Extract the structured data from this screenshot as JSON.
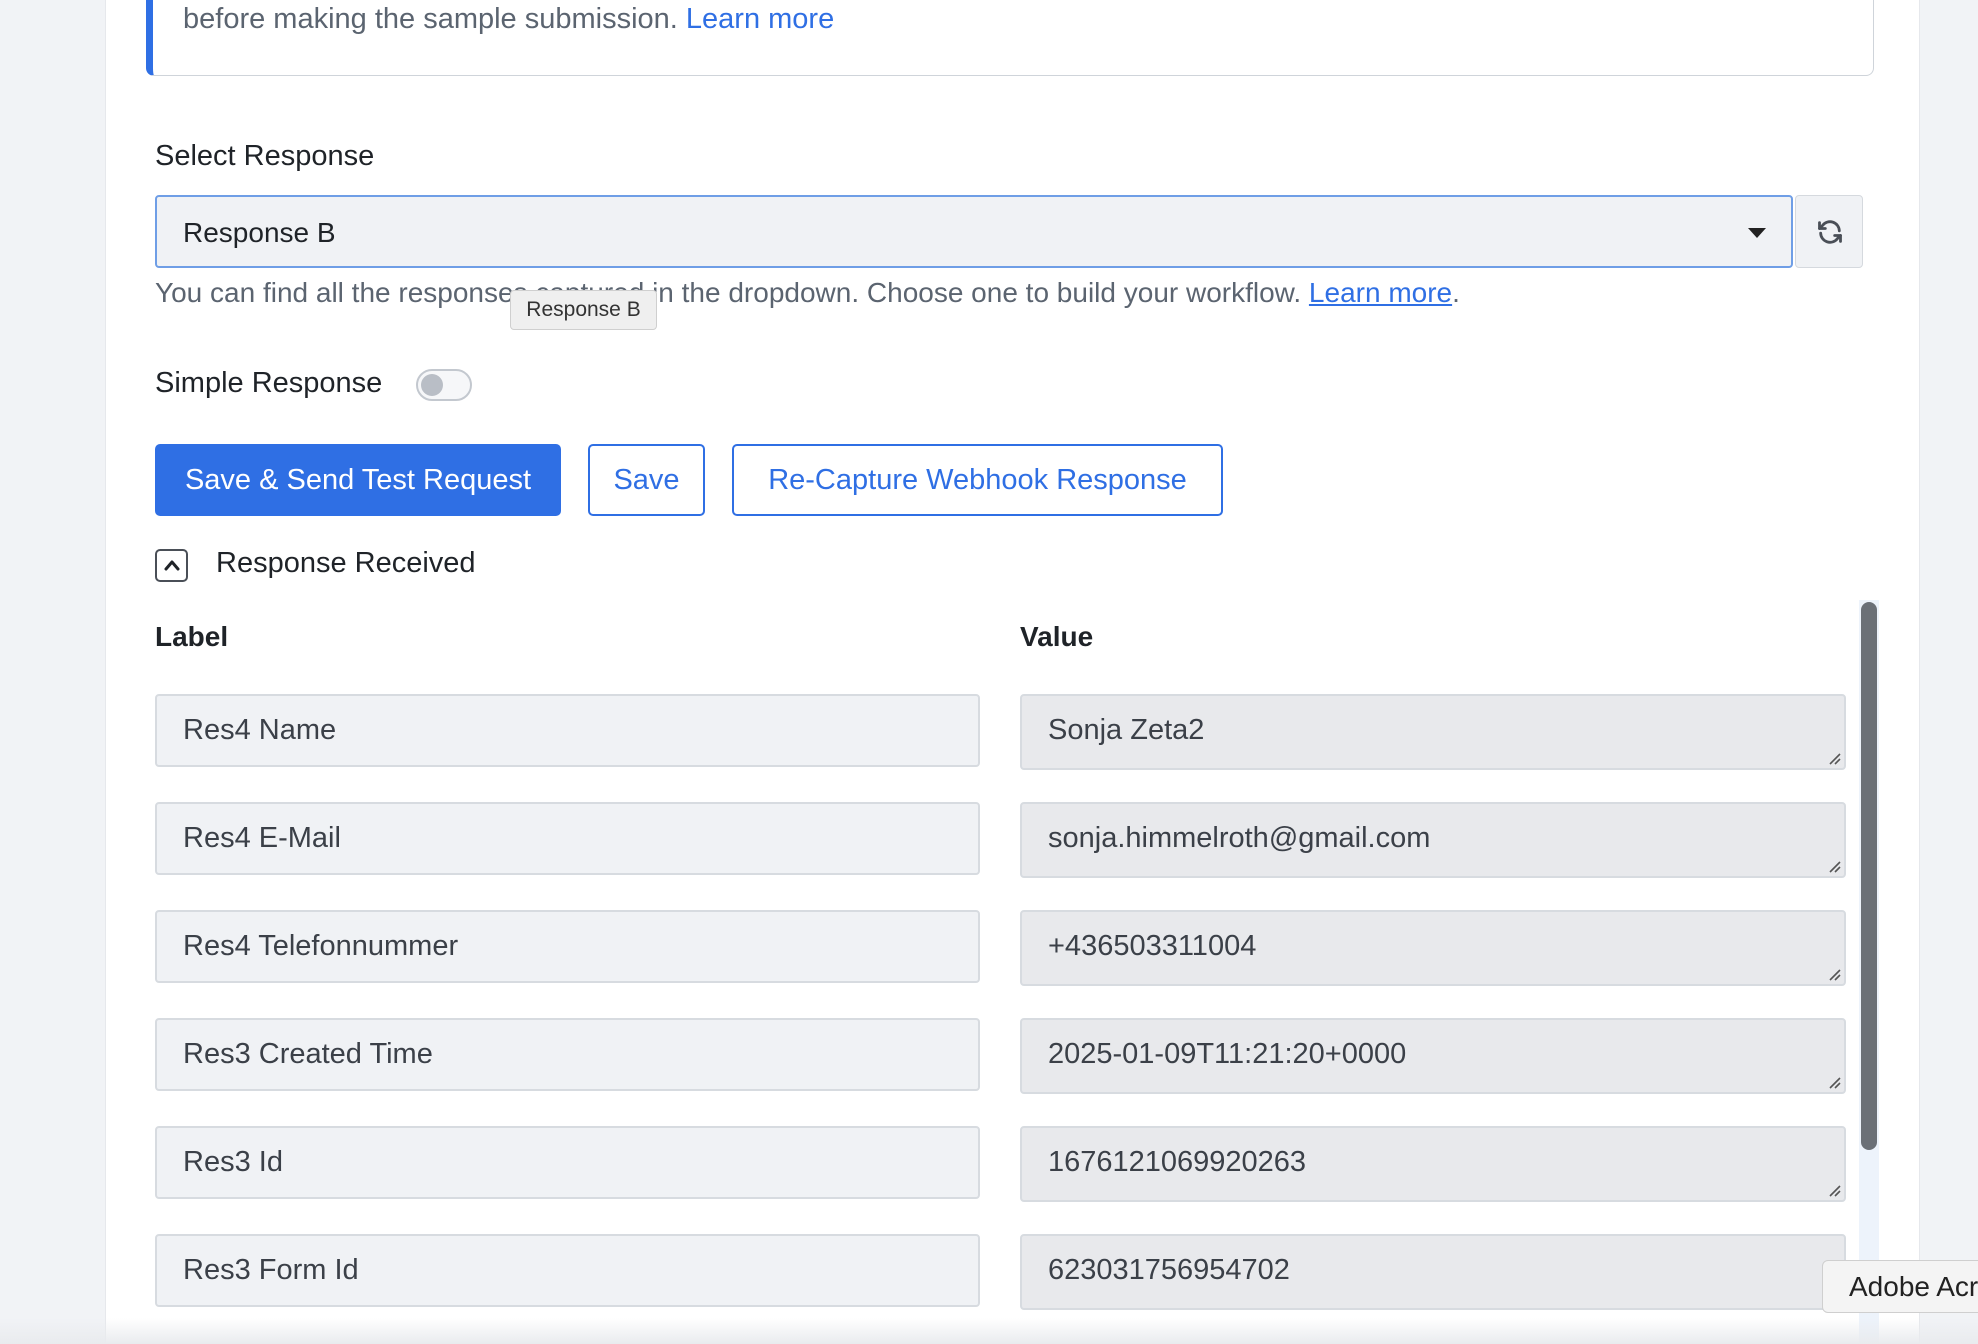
{
  "info": {
    "text": "before making the sample submission.",
    "link": "Learn more"
  },
  "select_response": {
    "label": "Select Response",
    "value": "Response B",
    "help_before": "You can find all the responses captured in the dropdown. Choose one to build your workflow.",
    "help_link": "Learn more",
    "help_after": ".",
    "tooltip": "Response B"
  },
  "simple_response": {
    "label": "Simple Response",
    "enabled": false
  },
  "buttons": {
    "save_send": "Save & Send Test Request",
    "save": "Save",
    "recapture": "Re-Capture Webhook Response"
  },
  "response_received": {
    "label": "Response Received",
    "columns": {
      "label": "Label",
      "value": "Value"
    },
    "rows": [
      {
        "label": "Res4 Name",
        "value": "Sonja Zeta2"
      },
      {
        "label": "Res4 E-Mail",
        "value": "sonja.himmelroth@gmail.com"
      },
      {
        "label": "Res4 Telefonnummer",
        "value": "+436503311004"
      },
      {
        "label": "Res3 Created Time",
        "value": "2025-01-09T11:21:20+0000"
      },
      {
        "label": "Res3 Id",
        "value": "1676121069920263"
      },
      {
        "label": "Res3 Form Id",
        "value": "623031756954702"
      }
    ]
  },
  "popup": {
    "text": "Adobe Acr"
  },
  "colors": {
    "accent": "#2f6fe4",
    "field_bg": "#f0f2f5",
    "value_bg": "#e8e9ec"
  },
  "icons": {
    "refresh": "refresh-icon",
    "collapse": "chevron-up-icon",
    "dropdown": "caret-down-icon",
    "resize": "resize-handle-icon"
  }
}
